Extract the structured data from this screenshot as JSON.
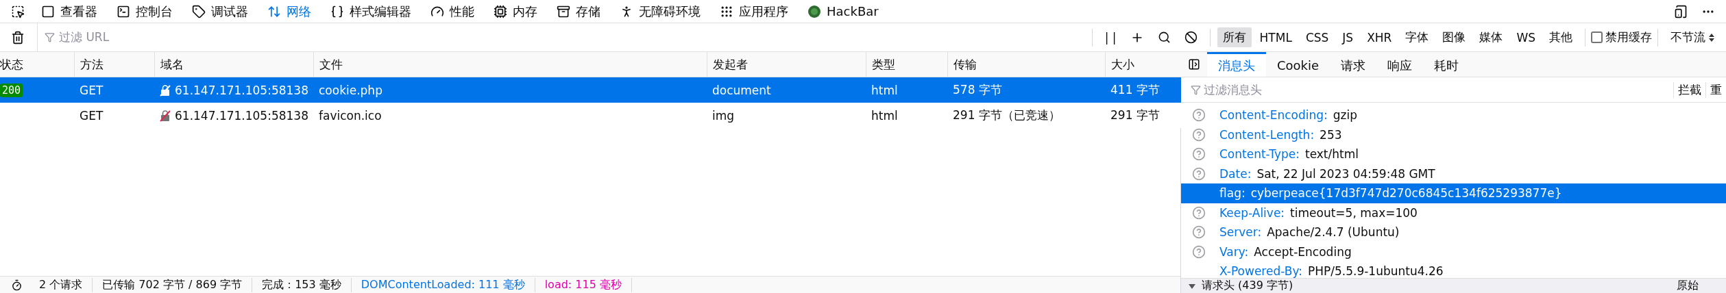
{
  "toolbar": {
    "tools": [
      {
        "label": "查看器",
        "selected": false
      },
      {
        "label": "控制台",
        "selected": false
      },
      {
        "label": "调试器",
        "selected": false
      },
      {
        "label": "网络",
        "selected": true
      },
      {
        "label": "样式编辑器",
        "selected": false
      },
      {
        "label": "性能",
        "selected": false
      },
      {
        "label": "内存",
        "selected": false
      },
      {
        "label": "存储",
        "selected": false
      },
      {
        "label": "无障碍环境",
        "selected": false
      },
      {
        "label": "应用程序",
        "selected": false
      },
      {
        "label": "HackBar",
        "selected": false
      }
    ]
  },
  "filter_bar": {
    "placeholder": "过滤 URL",
    "pause_label": "| |",
    "type_filters": [
      {
        "label": "所有",
        "selected": true
      },
      {
        "label": "HTML",
        "selected": false
      },
      {
        "label": "CSS",
        "selected": false
      },
      {
        "label": "JS",
        "selected": false
      },
      {
        "label": "XHR",
        "selected": false
      },
      {
        "label": "字体",
        "selected": false
      },
      {
        "label": "图像",
        "selected": false
      },
      {
        "label": "媒体",
        "selected": false
      },
      {
        "label": "WS",
        "selected": false
      },
      {
        "label": "其他",
        "selected": false
      }
    ],
    "disable_cache": {
      "label": "禁用缓存",
      "checked": false
    },
    "throttle": "不节流"
  },
  "table": {
    "columns": [
      "状态",
      "方法",
      "域名",
      "文件",
      "发起者",
      "类型",
      "传输",
      "大小"
    ],
    "rows": [
      {
        "selected": true,
        "status": "200",
        "method": "GET",
        "domain": "61.147.171.105:58138",
        "file": "cookie.php",
        "initiator": "document",
        "type": "html",
        "transferred": "578 字节",
        "size": "411 字节"
      },
      {
        "selected": false,
        "method": "GET",
        "domain": "61.147.171.105:58138",
        "file": "favicon.ico",
        "initiator": "img",
        "type": "html",
        "transferred": "291 字节（已竞速）",
        "size": "291 字节"
      }
    ]
  },
  "status_bar": {
    "items": [
      {
        "text": "2 个请求",
        "kind": "plain"
      },
      {
        "text": "已传输 702 字节 / 869 字节",
        "kind": "plain"
      },
      {
        "text": "完成：153 毫秒",
        "kind": "plain"
      },
      {
        "text": "DOMContentLoaded: 111 毫秒",
        "kind": "dom"
      },
      {
        "text": "load: 115 毫秒",
        "kind": "load"
      }
    ]
  },
  "sidebar": {
    "tabs": [
      {
        "label": "消息头",
        "selected": true
      },
      {
        "label": "Cookie",
        "selected": false
      },
      {
        "label": "请求",
        "selected": false
      },
      {
        "label": "响应",
        "selected": false
      },
      {
        "label": "耗时",
        "selected": false
      }
    ],
    "filter_placeholder": "过滤消息头",
    "buttons": [
      "拦截",
      "重"
    ],
    "response_headers": [
      {
        "name": "Content-Encoding:",
        "value": "gzip",
        "help": true,
        "selected": false
      },
      {
        "name": "Content-Length:",
        "value": "253",
        "help": true,
        "selected": false
      },
      {
        "name": "Content-Type:",
        "value": "text/html",
        "help": true,
        "selected": false
      },
      {
        "name": "Date:",
        "value": "Sat, 22 Jul 2023 04:59:48 GMT",
        "help": true,
        "selected": false
      },
      {
        "name": "flag:",
        "value": "cyberpeace{17d3f747d270c6845c134f625293877e}",
        "help": false,
        "selected": true
      },
      {
        "name": "Keep-Alive:",
        "value": "timeout=5, max=100",
        "help": true,
        "selected": false
      },
      {
        "name": "Server:",
        "value": "Apache/2.4.7 (Ubuntu)",
        "help": true,
        "selected": false
      },
      {
        "name": "Vary:",
        "value": "Accept-Encoding",
        "help": true,
        "selected": false
      },
      {
        "name": "X-Powered-By:",
        "value": "PHP/5.5.9-1ubuntu4.26",
        "help": false,
        "selected": false
      }
    ],
    "request_section": {
      "title": "请求头 (439 字节)",
      "raw_label": "原始"
    }
  }
}
